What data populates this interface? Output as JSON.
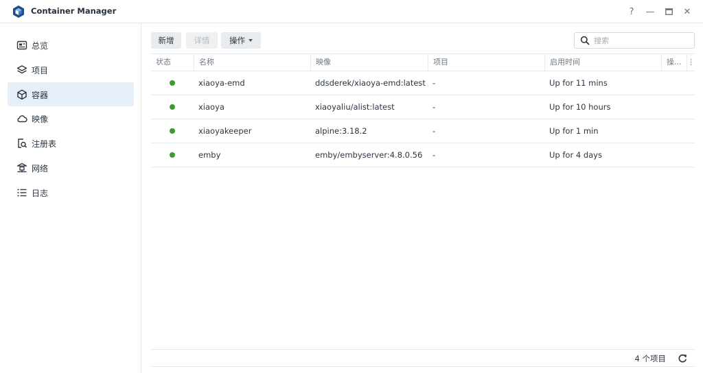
{
  "app": {
    "title": "Container Manager",
    "icon": "container-manager-logo-icon",
    "brand_color": "#1d4f8f"
  },
  "window_controls": {
    "help": "?",
    "minimize": "—",
    "maximize": "❐",
    "close": "✕"
  },
  "sidebar": {
    "items": [
      {
        "label": "总览",
        "icon": "overview-icon",
        "active": false
      },
      {
        "label": "项目",
        "icon": "layers-icon",
        "active": false
      },
      {
        "label": "容器",
        "icon": "box-icon",
        "active": true
      },
      {
        "label": "映像",
        "icon": "cloud-icon",
        "active": false
      },
      {
        "label": "注册表",
        "icon": "registry-search-icon",
        "active": false
      },
      {
        "label": "网络",
        "icon": "network-icon",
        "active": false
      },
      {
        "label": "日志",
        "icon": "list-icon",
        "active": false
      }
    ]
  },
  "toolbar": {
    "add_label": "新增",
    "details_label": "详情",
    "actions_label": "操作",
    "search_placeholder": "搜索"
  },
  "table": {
    "columns": [
      "状态",
      "名称",
      "映像",
      "项目",
      "启用时间",
      "操..."
    ],
    "rows": [
      {
        "status": "running",
        "name": "xiaoya-emd",
        "image": "ddsderek/xiaoya-emd:latest",
        "project": "-",
        "uptime": "Up for 11 mins"
      },
      {
        "status": "running",
        "name": "xiaoya",
        "image": "xiaoyaliu/alist:latest",
        "project": "-",
        "uptime": "Up for 10 hours"
      },
      {
        "status": "running",
        "name": "xiaoyakeeper",
        "image": "alpine:3.18.2",
        "project": "-",
        "uptime": "Up for 1 min"
      },
      {
        "status": "running",
        "name": "emby",
        "image": "emby/embyserver:4.8.0.56",
        "project": "-",
        "uptime": "Up for 4 days"
      }
    ],
    "status_color": "#3c9b2c"
  },
  "footer": {
    "count_label": "4 个项目"
  }
}
